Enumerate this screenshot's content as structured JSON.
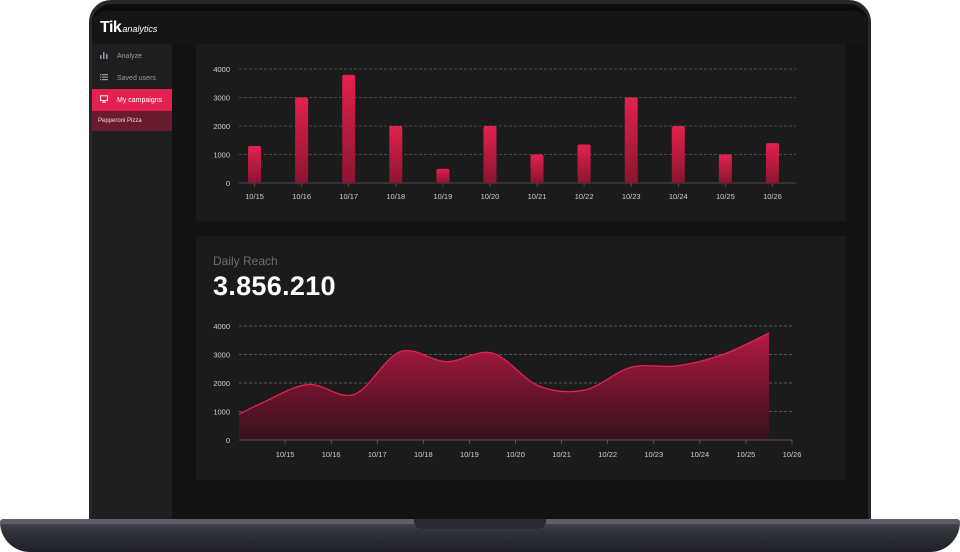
{
  "app": {
    "brand_main": "Tik",
    "brand_sub": "analytics"
  },
  "sidebar": {
    "items": [
      {
        "label": "Analyze",
        "icon": "bar-chart-icon",
        "active": false
      },
      {
        "label": "Saved users",
        "icon": "list-icon",
        "active": false
      },
      {
        "label": "My campaigns",
        "icon": "monitor-icon",
        "active": true
      }
    ],
    "sub_item": "Pepperoni Pizza"
  },
  "colors": {
    "accent": "#e3214f",
    "accent_dark": "#6a1a2d",
    "background": "#131313",
    "card": "#1b1b1c"
  },
  "daily_reach": {
    "title": "Daily Reach",
    "value": "3.856.210"
  },
  "chart_data": [
    {
      "type": "bar",
      "title": "",
      "xlabel": "",
      "ylabel": "",
      "ylim": [
        0,
        4000
      ],
      "yticks": [
        0,
        1000,
        2000,
        3000,
        4000
      ],
      "grid": true,
      "categories": [
        "10/15",
        "10/16",
        "10/17",
        "10/18",
        "10/19",
        "10/20",
        "10/21",
        "10/22",
        "10/23",
        "10/24",
        "10/25",
        "10/26"
      ],
      "values": [
        1300,
        3000,
        3800,
        2000,
        500,
        2000,
        1000,
        1350,
        3000,
        2000,
        1000,
        1400
      ]
    },
    {
      "type": "area",
      "title": "Daily Reach",
      "xlabel": "",
      "ylabel": "",
      "ylim": [
        0,
        4000
      ],
      "yticks": [
        0,
        1000,
        2000,
        3000,
        4000
      ],
      "grid": true,
      "categories": [
        "10/15",
        "10/16",
        "10/17",
        "10/18",
        "10/19",
        "10/20",
        "10/21",
        "10/22",
        "10/23",
        "10/24",
        "10/25",
        "10/26"
      ],
      "x": [
        0.5,
        1.5,
        2.5,
        3.5,
        4.5,
        5.5,
        6.5,
        7.5,
        8.5,
        9.5,
        10.5,
        11.5
      ],
      "values": [
        1300,
        1950,
        1600,
        3100,
        2750,
        3050,
        1900,
        1750,
        2550,
        2600,
        3000,
        3750
      ],
      "start_value": 900
    }
  ]
}
